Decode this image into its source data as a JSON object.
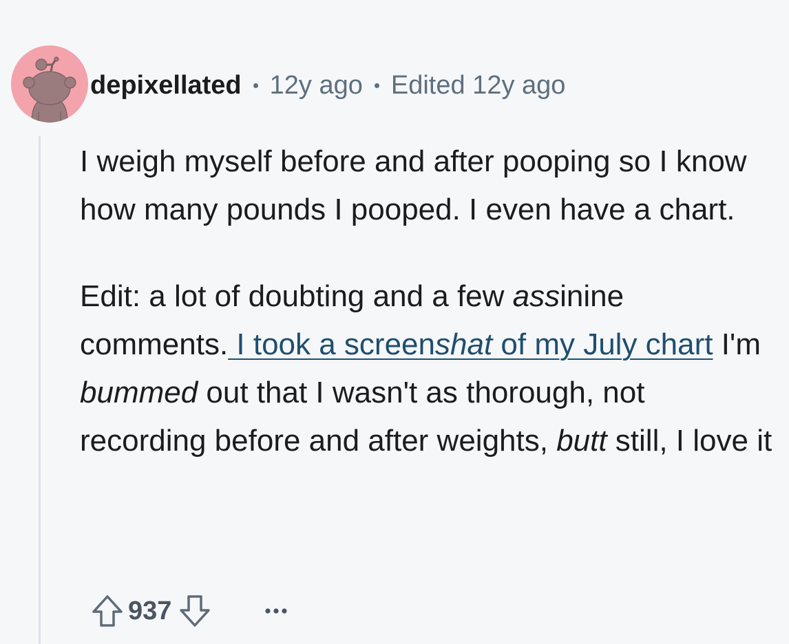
{
  "comment": {
    "author": "depixellated",
    "posted_ago": "12y ago",
    "edited": "Edited 12y ago",
    "body": {
      "paragraph1": "I weigh myself before and after pooping so I know how many pounds I pooped. I even have a chart.",
      "p2_text1": "Edit: a lot of doubting and a few ",
      "p2_italic1": "ass",
      "p2_text2": "inine comments.",
      "link_text1": " I took a screen",
      "link_italic": "shat",
      "link_text2": " of my July chart",
      "p2_text3": " I'm ",
      "p2_italic2": "bummed",
      "p2_text4": " out that I wasn't as thorough, not recording before and after weights, ",
      "p2_italic3": "butt",
      "p2_text5": " still, I love it"
    }
  },
  "actions": {
    "score": "937",
    "upvote_icon": "upvote-arrow-icon",
    "downvote_icon": "downvote-arrow-icon",
    "more_icon": "more-options-icon"
  },
  "colors": {
    "background": "#f6f7f9",
    "avatar_bg": "#f3a3ab",
    "link": "#1f4e6e",
    "meta_text": "#5d6f7f"
  }
}
